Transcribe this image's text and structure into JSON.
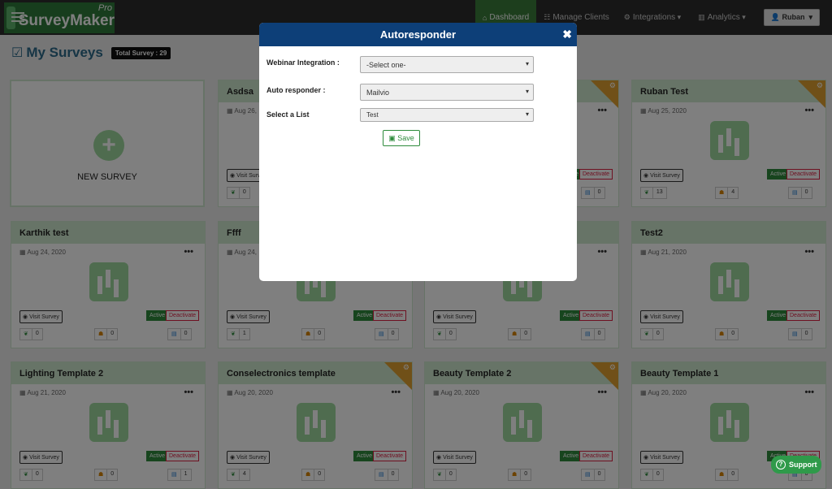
{
  "app": {
    "brand": "SurveyMaker",
    "brand_suffix": "Pro"
  },
  "nav": {
    "dashboard": "Dashboard",
    "manage_clients": "Manage Clients",
    "integrations": "Integrations",
    "analytics": "Analytics",
    "user": "Ruban"
  },
  "page": {
    "title": "My Surveys",
    "total_badge": "Total Survey : 29"
  },
  "new_survey": {
    "label": "NEW SURVEY"
  },
  "card_labels": {
    "visit": "Visit Survey",
    "active": "Active",
    "deactivate": "Deactivate"
  },
  "cards": [
    {
      "title": "Asdsa",
      "date": "Aug 26,",
      "stats": [
        "0",
        "",
        ""
      ],
      "ribbon": false
    },
    {
      "title": "",
      "date": "",
      "stats": [
        "",
        "",
        "0"
      ],
      "ribbon": true
    },
    {
      "title": "Ruban Test",
      "date": "Aug 25, 2020",
      "stats": [
        "13",
        "4",
        "0"
      ],
      "ribbon": true
    },
    {
      "title": "Karthik test",
      "date": "Aug 24, 2020",
      "stats": [
        "0",
        "0",
        "0"
      ],
      "ribbon": false
    },
    {
      "title": "Ffff",
      "date": "Aug 24,",
      "stats": [
        "1",
        "0",
        "0"
      ],
      "ribbon": false
    },
    {
      "title": "",
      "date": "",
      "stats": [
        "0",
        "0",
        "0"
      ],
      "ribbon": false
    },
    {
      "title": "Test2",
      "date": "Aug 21, 2020",
      "stats": [
        "0",
        "0",
        "0"
      ],
      "ribbon": false
    },
    {
      "title": "Lighting Template 2",
      "date": "Aug 21, 2020",
      "stats": [
        "0",
        "0",
        "1"
      ],
      "ribbon": false
    },
    {
      "title": "Conselectronics template",
      "date": "Aug 20, 2020",
      "stats": [
        "4",
        "0",
        "0"
      ],
      "ribbon": true
    },
    {
      "title": "Beauty Template 2",
      "date": "Aug 20, 2020",
      "stats": [
        "0",
        "0",
        "0"
      ],
      "ribbon": true
    },
    {
      "title": "Beauty Template 1",
      "date": "Aug 20, 2020",
      "stats": [
        "0",
        "0",
        "0"
      ],
      "ribbon": false
    }
  ],
  "modal": {
    "title": "Autoresponder",
    "close": "✖",
    "webinar_label": "Webinar Integration :",
    "webinar_value": "-Select one-",
    "autoresponder_label": "Auto responder :",
    "autoresponder_value": "Mailvio",
    "list_label": "Select a List",
    "list_value": "Test",
    "save": "Save"
  },
  "support": {
    "label": "Support"
  },
  "colors": {
    "nav_active": "#3a7d3a",
    "modal_header": "#0d3f78",
    "card_header": "#cfe9cf",
    "ribbon": "#e0a030",
    "support": "#2f9a4a"
  }
}
